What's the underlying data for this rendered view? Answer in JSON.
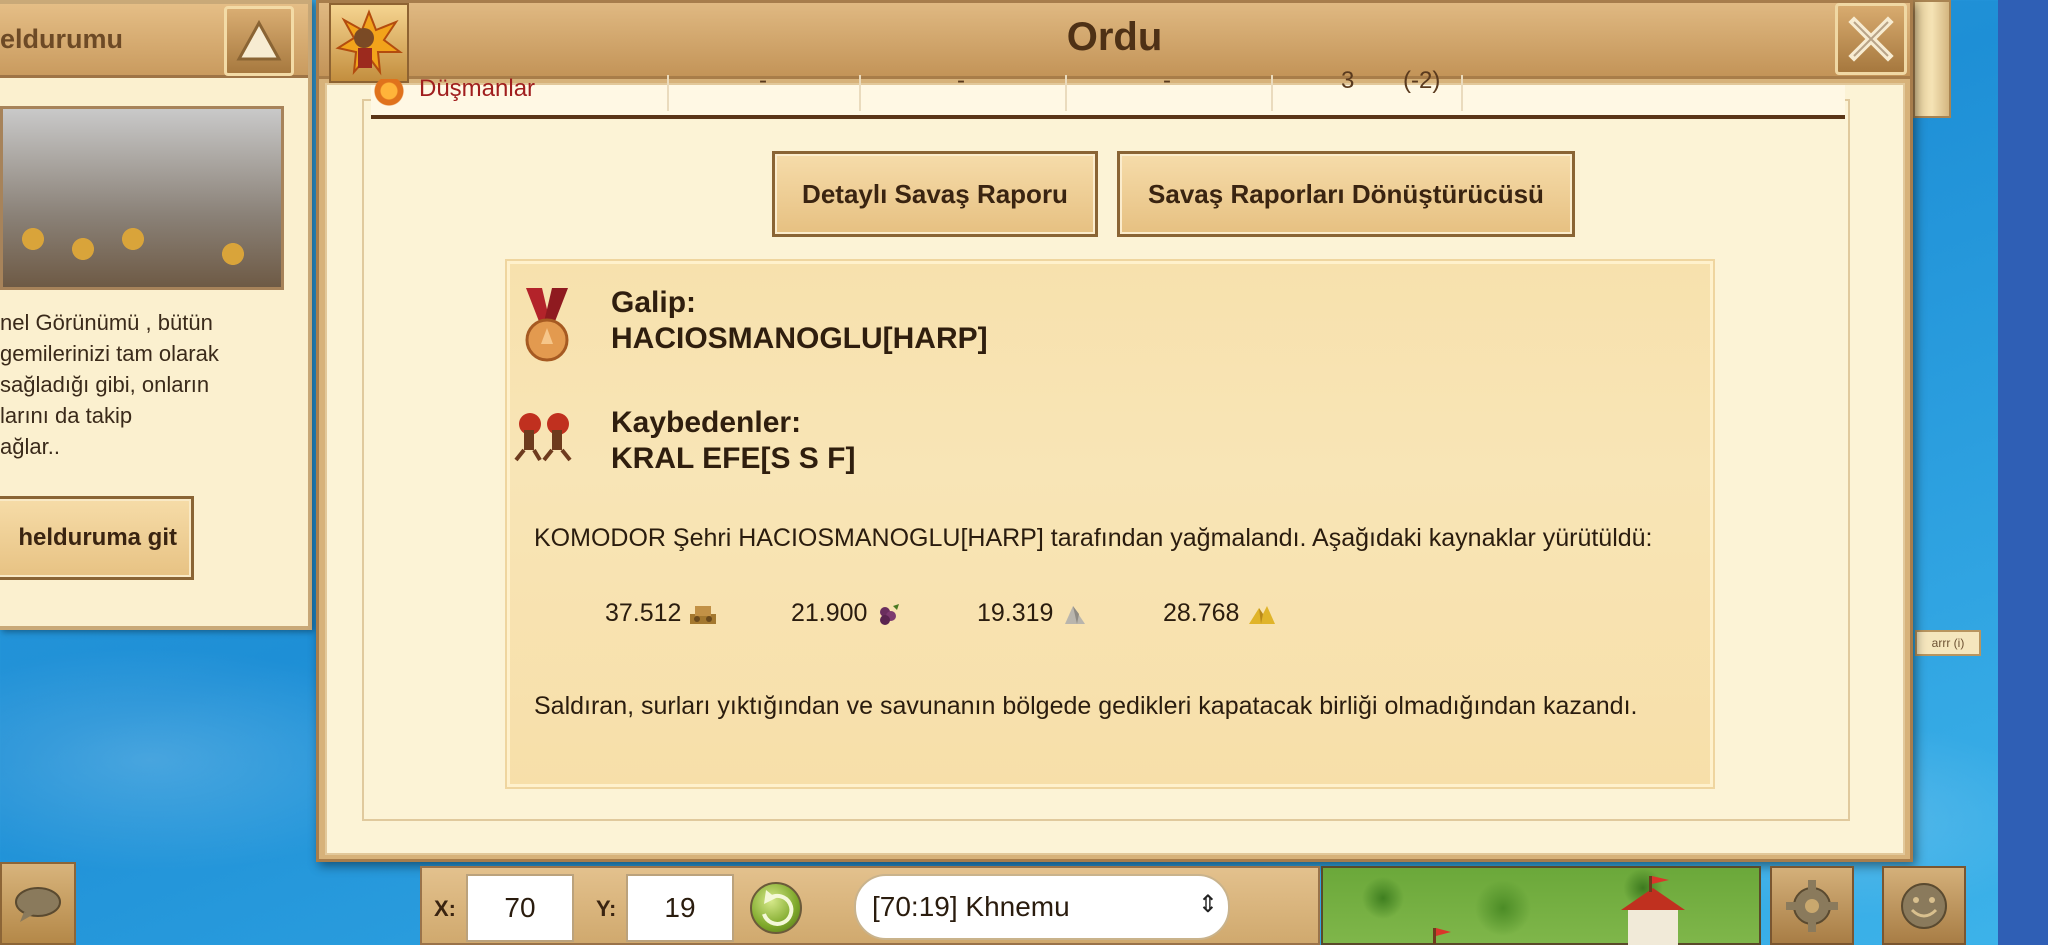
{
  "left_panel": {
    "title": "eldurumu",
    "description_lines": [
      "nel Görünümü , bütün",
      " gemilerinizi tam olarak",
      " sağladığı gibi, onların",
      "larını da takip",
      "ağlar.."
    ],
    "goto_button": "helduruma git"
  },
  "modal": {
    "title": "Ordu",
    "enemy_row": {
      "label": "Düşmanlar",
      "cells": [
        "-",
        "-",
        "-",
        "3",
        "(-2)"
      ]
    },
    "buttons": {
      "detailed_report": "Detaylı Savaş Raporu",
      "report_converter": "Savaş Raporları Dönüştürücüsü"
    },
    "result": {
      "winner_label": "Galip:",
      "winner_name": "HACIOSMANOGLU[HARP]",
      "losers_label": "Kaybedenler:",
      "loser_name": "KRAL EFE[S S F]",
      "plunder_text": "KOMODOR Şehri HACIOSMANOGLU[HARP] tarafından yağmalandı. Aşağıdaki kaynaklar yürütüldü:",
      "resources": [
        {
          "amount": "37.512",
          "icon": "wood-icon"
        },
        {
          "amount": "21.900",
          "icon": "wine-icon"
        },
        {
          "amount": "19.319",
          "icon": "marble-icon"
        },
        {
          "amount": "28.768",
          "icon": "sulfur-icon"
        }
      ],
      "outcome_text": "Saldıran, surları yıktığından ve savunanın bölgede gedikleri kapatacak birliği olmadığından kazandı."
    }
  },
  "toolbar": {
    "x_label": "X:",
    "x_value": "70",
    "y_label": "Y:",
    "y_value": "19",
    "city_selected": "[70:19] Khnemu"
  },
  "right_tag": "arrr (i)"
}
